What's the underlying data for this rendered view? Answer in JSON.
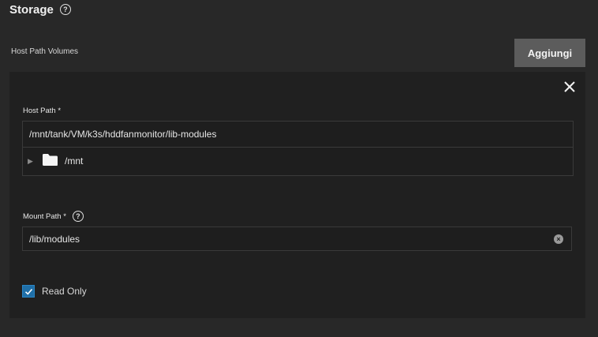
{
  "section": {
    "title": "Storage",
    "help_icon": "question-circle-icon"
  },
  "host_path_volumes": {
    "label": "Host Path Volumes",
    "add_label": "Aggiungi"
  },
  "card": {
    "close_icon": "close-icon",
    "host_path": {
      "label": "Host Path *",
      "value": "/mnt/tank/VM/k3s/hddfanmonitor/lib-modules",
      "tree": {
        "expand_icon": "triangle-right-icon",
        "folder_icon": "folder-icon",
        "label": "/mnt"
      }
    },
    "mount_path": {
      "label": "Mount Path *",
      "help_icon": "question-circle-icon",
      "value": "/lib/modules",
      "clear_icon": "clear-circle-icon"
    },
    "read_only": {
      "label": "Read Only",
      "checked": true
    }
  },
  "colors": {
    "background": "#282828",
    "card": "#202020",
    "button": "#5c5c5c",
    "checkbox": "#1f6fa8"
  }
}
